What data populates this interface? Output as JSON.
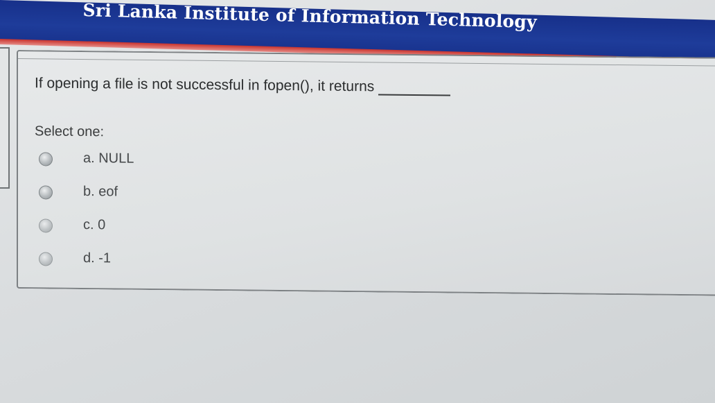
{
  "header": {
    "title": "Sri Lanka Institute of Information Technology",
    "brand_color": "#1e3c9a",
    "accent_color": "#c9332d"
  },
  "question": {
    "text": "If opening a file is not successful in fopen(), it returns",
    "select_label": "Select one:",
    "options": [
      {
        "label": "a. NULL"
      },
      {
        "label": "b. eof"
      },
      {
        "label": "c. 0"
      },
      {
        "label": "d. -1"
      }
    ]
  }
}
